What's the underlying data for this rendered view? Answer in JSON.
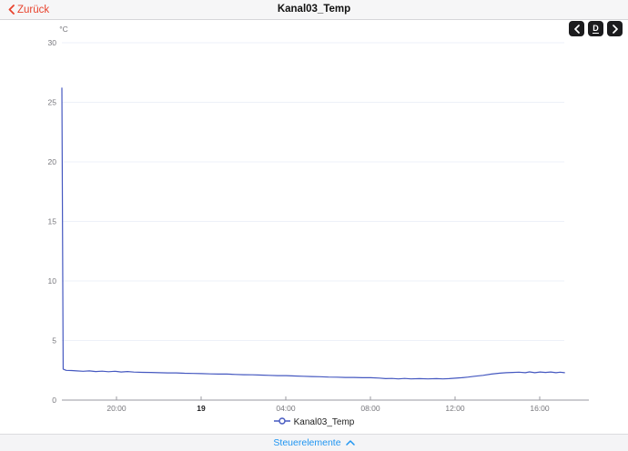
{
  "header": {
    "back_label": "Zurück",
    "title": "Kanal03_Temp"
  },
  "nav": {
    "prev_icon": "chevron-left",
    "day_label": "D",
    "next_icon": "chevron-right"
  },
  "chart_data": {
    "type": "line",
    "title": "Kanal03_Temp",
    "unit_label": "°C",
    "ylabel": "°C",
    "ylim": [
      0,
      30
    ],
    "y_ticks": [
      0,
      5,
      10,
      15,
      20,
      25,
      30
    ],
    "grid": true,
    "x_ticks": [
      {
        "label": "20:00",
        "hour": 2.58,
        "emphasis": false
      },
      {
        "label": "19",
        "hour": 6.58,
        "emphasis": true
      },
      {
        "label": "04:00",
        "hour": 10.58,
        "emphasis": false
      },
      {
        "label": "08:00",
        "hour": 14.58,
        "emphasis": false
      },
      {
        "label": "12:00",
        "hour": 18.58,
        "emphasis": false
      },
      {
        "label": "16:00",
        "hour": 22.58,
        "emphasis": false
      }
    ],
    "xlim_hours": [
      0,
      23.75
    ],
    "legend_position": "bottom",
    "series": [
      {
        "name": "Kanal03_Temp",
        "color": "#4558c0",
        "points": [
          [
            0,
            26.2
          ],
          [
            0.06,
            2.6
          ],
          [
            0.2,
            2.5
          ],
          [
            0.45,
            2.48
          ],
          [
            0.7,
            2.45
          ],
          [
            1,
            2.42
          ],
          [
            1.3,
            2.45
          ],
          [
            1.6,
            2.4
          ],
          [
            1.9,
            2.43
          ],
          [
            2.2,
            2.38
          ],
          [
            2.5,
            2.42
          ],
          [
            2.8,
            2.36
          ],
          [
            3.1,
            2.4
          ],
          [
            3.4,
            2.35
          ],
          [
            3.8,
            2.33
          ],
          [
            4.2,
            2.32
          ],
          [
            4.6,
            2.3
          ],
          [
            5,
            2.28
          ],
          [
            5.4,
            2.28
          ],
          [
            5.8,
            2.25
          ],
          [
            6.2,
            2.24
          ],
          [
            6.6,
            2.22
          ],
          [
            7,
            2.2
          ],
          [
            7.4,
            2.18
          ],
          [
            7.8,
            2.18
          ],
          [
            8.2,
            2.15
          ],
          [
            8.6,
            2.13
          ],
          [
            9,
            2.12
          ],
          [
            9.4,
            2.1
          ],
          [
            9.8,
            2.08
          ],
          [
            10.2,
            2.05
          ],
          [
            10.6,
            2.05
          ],
          [
            11,
            2.02
          ],
          [
            11.4,
            2
          ],
          [
            11.8,
            1.98
          ],
          [
            12.2,
            1.96
          ],
          [
            12.6,
            1.93
          ],
          [
            13,
            1.92
          ],
          [
            13.4,
            1.9
          ],
          [
            13.8,
            1.9
          ],
          [
            14.2,
            1.88
          ],
          [
            14.6,
            1.88
          ],
          [
            15,
            1.85
          ],
          [
            15.3,
            1.8
          ],
          [
            15.6,
            1.82
          ],
          [
            15.9,
            1.78
          ],
          [
            16.2,
            1.82
          ],
          [
            16.5,
            1.78
          ],
          [
            16.9,
            1.8
          ],
          [
            17.3,
            1.78
          ],
          [
            17.7,
            1.8
          ],
          [
            18,
            1.78
          ],
          [
            18.3,
            1.8
          ],
          [
            18.6,
            1.84
          ],
          [
            18.9,
            1.88
          ],
          [
            19.2,
            1.93
          ],
          [
            19.5,
            2
          ],
          [
            19.9,
            2.08
          ],
          [
            20.3,
            2.18
          ],
          [
            20.7,
            2.26
          ],
          [
            21,
            2.3
          ],
          [
            21.3,
            2.32
          ],
          [
            21.6,
            2.34
          ],
          [
            21.9,
            2.3
          ],
          [
            22.1,
            2.37
          ],
          [
            22.35,
            2.3
          ],
          [
            22.6,
            2.36
          ],
          [
            22.85,
            2.32
          ],
          [
            23.1,
            2.36
          ],
          [
            23.35,
            2.3
          ],
          [
            23.55,
            2.34
          ],
          [
            23.75,
            2.3
          ]
        ]
      }
    ]
  },
  "legend": {
    "label": "Kanal03_Temp"
  },
  "footer": {
    "controls_label": "Steuerelemente"
  },
  "colors": {
    "accent_red": "#e8432d",
    "link_blue": "#1e95f2",
    "line_blue": "#4558c0",
    "grid_line": "#edf1f8",
    "axis_gray": "#9a9aa0",
    "tick_text": "#77777c",
    "button_bg": "#1c1c1e"
  }
}
